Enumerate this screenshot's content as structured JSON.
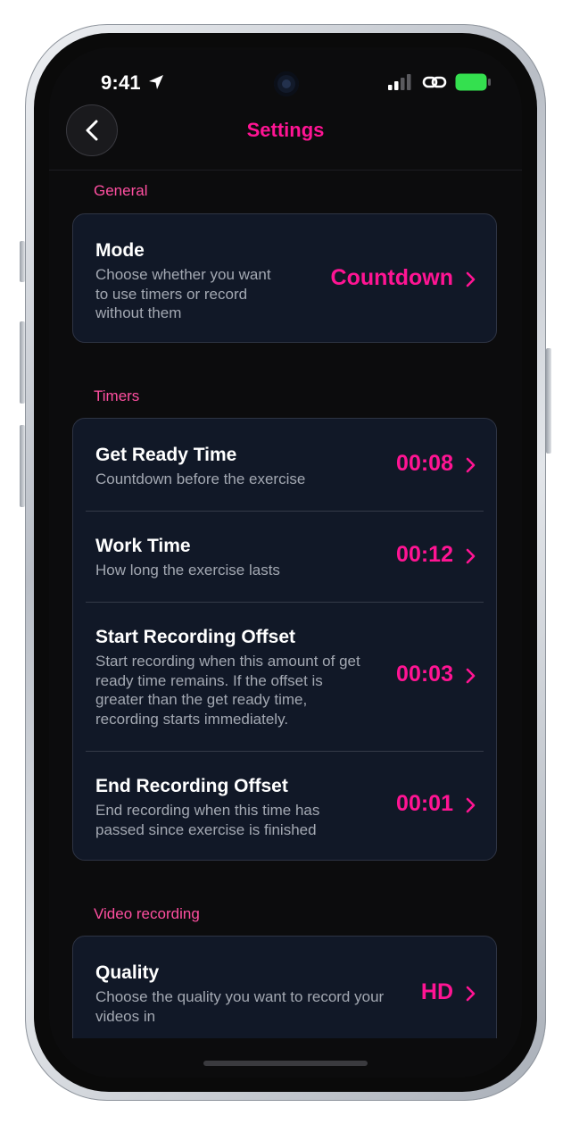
{
  "status_bar": {
    "time": "9:41"
  },
  "header": {
    "title": "Settings"
  },
  "sections": [
    {
      "header": "General",
      "rows": [
        {
          "title": "Mode",
          "description": "Choose whether you want to use timers or record without them",
          "value": "Countdown"
        }
      ]
    },
    {
      "header": "Timers",
      "rows": [
        {
          "title": "Get Ready Time",
          "description": "Countdown before the exercise",
          "value": "00:08"
        },
        {
          "title": "Work Time",
          "description": "How long the exercise lasts",
          "value": "00:12"
        },
        {
          "title": "Start Recording Offset",
          "description": "Start recording when this amount of get ready time remains. If the offset is greater than the get ready time, recording starts immediately.",
          "value": "00:03"
        },
        {
          "title": "End Recording Offset",
          "description": "End recording when this time has passed since exercise is finished",
          "value": "00:01"
        }
      ]
    },
    {
      "header": "Video recording",
      "rows": [
        {
          "title": "Quality",
          "description": "Choose the quality you want to record your videos in",
          "value": "HD"
        }
      ]
    }
  ],
  "colors": {
    "accent": "#ff1493",
    "section_header": "#ff4fa0",
    "card_bg": "#111827",
    "screen_bg": "#0c0c0d",
    "battery": "#34e04f"
  },
  "icons": {
    "back": "chevron-left-icon",
    "row": "chevron-right-icon",
    "location": "location-arrow-icon"
  }
}
